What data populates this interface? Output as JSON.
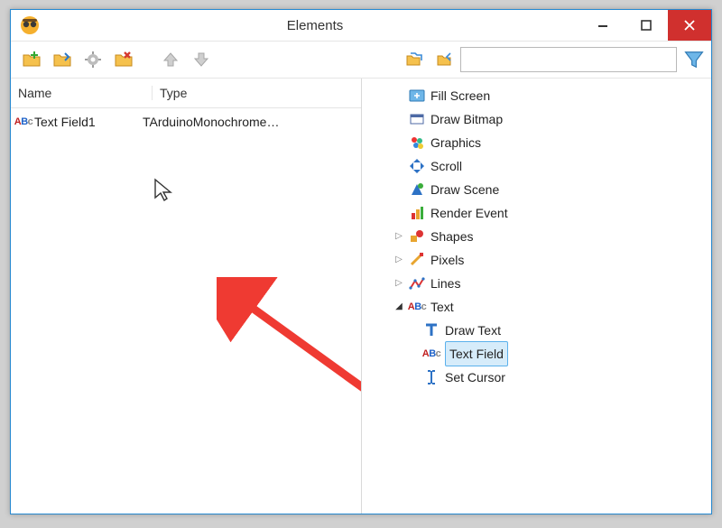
{
  "title": "Elements",
  "toolbar": {
    "t1": "add-folder",
    "t2": "open-folder",
    "t3": "settings",
    "t4": "delete-folder",
    "t5": "move-up",
    "t6": "move-down",
    "t7": "copy",
    "t8": "paste",
    "search_placeholder": ""
  },
  "headers": {
    "name": "Name",
    "type": "Type"
  },
  "rows": [
    {
      "name": "Text Field1",
      "type": "TArduinoMonochrome…"
    }
  ],
  "tree": {
    "items": [
      {
        "label": "Fill Screen",
        "icon": "fill"
      },
      {
        "label": "Draw Bitmap",
        "icon": "bitmap"
      },
      {
        "label": "Graphics",
        "icon": "graphics"
      },
      {
        "label": "Scroll",
        "icon": "scroll"
      },
      {
        "label": "Draw Scene",
        "icon": "scene"
      },
      {
        "label": "Render Event",
        "icon": "event"
      },
      {
        "label": "Shapes",
        "icon": "shapes",
        "twisty": "closed"
      },
      {
        "label": "Pixels",
        "icon": "pixels",
        "twisty": "closed"
      },
      {
        "label": "Lines",
        "icon": "lines",
        "twisty": "closed"
      },
      {
        "label": "Text",
        "icon": "abc",
        "twisty": "open"
      }
    ],
    "text_children": [
      {
        "label": "Draw Text",
        "icon": "drawtext"
      },
      {
        "label": "Text Field",
        "icon": "abc",
        "selected": true
      },
      {
        "label": "Set Cursor",
        "icon": "cursor"
      }
    ]
  }
}
